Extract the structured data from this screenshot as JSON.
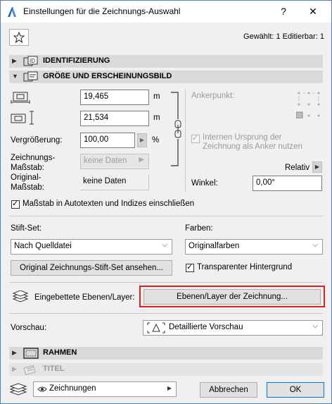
{
  "window": {
    "title": "Einstellungen für die Zeichnungs-Auswahl",
    "help": "?",
    "close": "✕"
  },
  "status": "Gewählt: 1 Editierbar: 1",
  "sections": {
    "identifizierung": "IDENTIFIZIERUNG",
    "groesse": "GRÖßE UND ERSCHEINUNGSBILD",
    "rahmen": "RAHMEN",
    "titel": "TITEL"
  },
  "size": {
    "width_value": "19,465",
    "height_value": "21,534",
    "unit_m": "m",
    "scale_label": "Vergrößerung:",
    "scale_value": "100,00",
    "percent": "%",
    "drawing_scale_label_1": "Zeichnungs-",
    "drawing_scale_label_2": "Maßstab:",
    "drawing_scale_value": "keine Daten",
    "original_scale_label_1": "Original-",
    "original_scale_label_2": "Maßstab:",
    "original_scale_value": "keine Daten"
  },
  "anchor": {
    "label": "Ankerpunkt:",
    "origin_label_1": "Internen Ursprung der",
    "origin_label_2": "Zeichnung als Anker nutzen",
    "relative": "Relativ",
    "angle_label": "Winkel:",
    "angle_value": "0,00°"
  },
  "autotext_checkbox": "Maßstab in Autotexten und Indizes einschließen",
  "pens": {
    "label": "Stift-Set:",
    "value": "Nach Quelldatei",
    "view_button": "Original Zeichnungs-Stift-Set ansehen..."
  },
  "colors": {
    "label": "Farben:",
    "value": "Originalfarben",
    "transparent": "Transparenter Hintergrund"
  },
  "layers": {
    "label": "Eingebettete Ebenen/Layer:",
    "button": "Ebenen/Layer der Zeichnung..."
  },
  "preview": {
    "label": "Vorschau:",
    "value": "Detaillierte Vorschau"
  },
  "footer": {
    "view_value": "Zeichnungen",
    "cancel": "Abbrechen",
    "ok": "OK"
  }
}
